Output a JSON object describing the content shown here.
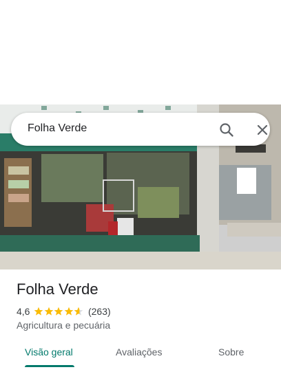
{
  "search": {
    "query": "Folha Verde",
    "search_icon": "search-icon",
    "close_icon": "close-icon"
  },
  "place": {
    "name": "Folha Verde",
    "rating": "4,6",
    "stars_value": 4.6,
    "reviews_count": "(263)",
    "category": "Agricultura e pecuária"
  },
  "tabs": [
    {
      "label": "Visão geral",
      "active": true
    },
    {
      "label": "Avaliações",
      "active": false
    },
    {
      "label": "Sobre",
      "active": false
    }
  ],
  "colors": {
    "accent": "#00796b",
    "star": "#fbbc04",
    "star_empty": "#dadce0"
  }
}
